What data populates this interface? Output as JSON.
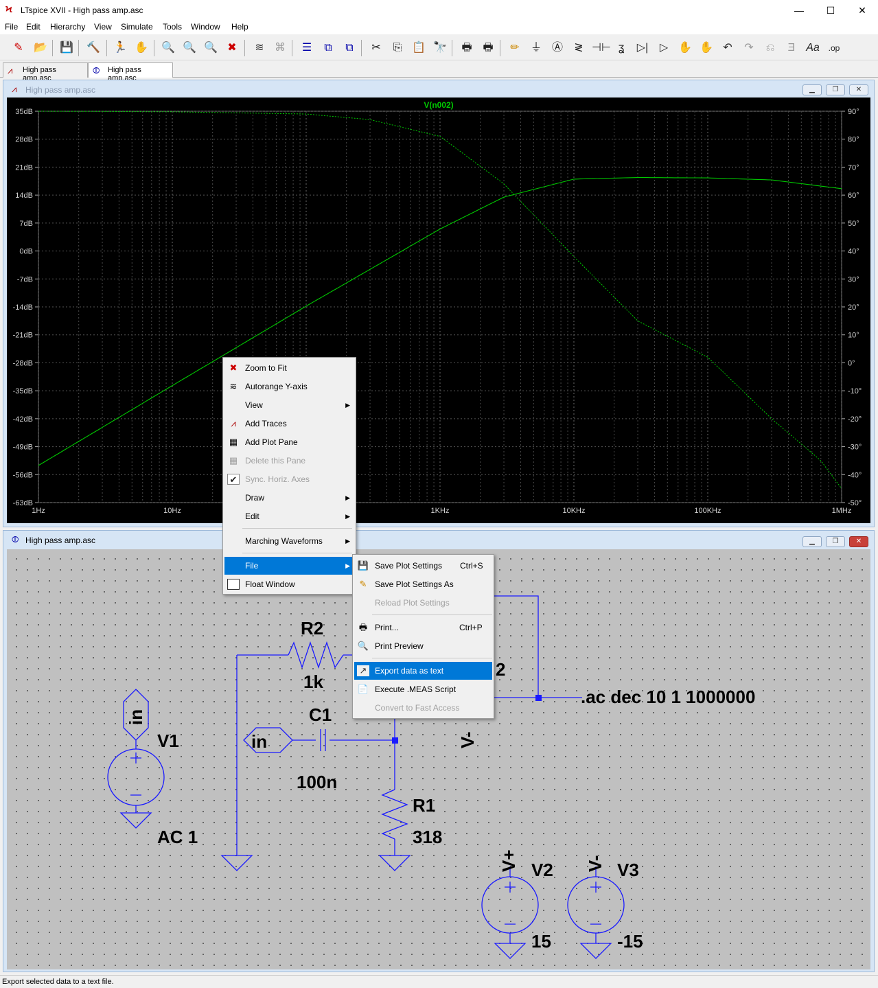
{
  "window": {
    "title": "LTspice XVII - High pass amp.asc",
    "min": "—",
    "max": "☐",
    "close": "✕"
  },
  "menubar": [
    "File",
    "Edit",
    "Hierarchy",
    "View",
    "Simulate",
    "Tools",
    "Window",
    "Help"
  ],
  "tabs": [
    {
      "label": "High pass amp.asc",
      "icon": "waveform-icon"
    },
    {
      "label": "High pass amp.asc",
      "icon": "schematic-icon"
    }
  ],
  "plot_window": {
    "title": "High pass amp.asc",
    "trace_label": "V(n002)",
    "trace_color": "#00c800",
    "x_ticks": [
      "1Hz",
      "10Hz",
      "100Hz",
      "1KHz",
      "10KHz",
      "100KHz",
      "1MHz"
    ],
    "left_ticks": [
      "35dB",
      "28dB",
      "21dB",
      "14dB",
      "7dB",
      "0dB",
      "-7dB",
      "-14dB",
      "-21dB",
      "-28dB",
      "-35dB",
      "-42dB",
      "-49dB",
      "-56dB",
      "-63dB"
    ],
    "right_ticks": [
      "90°",
      "80°",
      "70°",
      "60°",
      "50°",
      "40°",
      "30°",
      "20°",
      "10°",
      "0°",
      "-10°",
      "-20°",
      "-30°",
      "-40°",
      "-50°"
    ]
  },
  "chart_data": {
    "type": "line",
    "title": "V(n002)",
    "x_scale": "log",
    "xlim": [
      1,
      1000000
    ],
    "ylim_left": [
      -63,
      35
    ],
    "ylim_right": [
      -50,
      90
    ],
    "grid": true,
    "series": [
      {
        "name": "V(n002)",
        "axis": "magnitude",
        "unit": "dB",
        "x": [
          1,
          10,
          100,
          1000,
          3000,
          10000,
          30000,
          100000,
          300000,
          1000000
        ],
        "y": [
          -53.7,
          -33.7,
          -13.8,
          5.5,
          13.5,
          18.0,
          18.4,
          18.3,
          17.8,
          15.6
        ]
      },
      {
        "name": "V(n002)",
        "axis": "phase",
        "unit": "°",
        "x": [
          1,
          10,
          100,
          300,
          1000,
          3000,
          10000,
          30000,
          100000,
          300000,
          700000,
          1000000
        ],
        "y": [
          90,
          89.8,
          89,
          87,
          81,
          64,
          38,
          15,
          2,
          -20,
          -35,
          -45
        ]
      }
    ]
  },
  "context_menu": {
    "items": [
      {
        "label": "Zoom to Fit",
        "icon": "zoom-fit-icon",
        "submenu": false,
        "disabled": false
      },
      {
        "label": "Autorange Y-axis",
        "icon": "autorange-icon",
        "submenu": false,
        "disabled": false
      },
      {
        "label": "View",
        "icon": "",
        "submenu": true,
        "disabled": false
      },
      {
        "label": "Add Traces",
        "icon": "add-traces-icon",
        "submenu": false,
        "disabled": false
      },
      {
        "label": "Add Plot Pane",
        "icon": "add-pane-icon",
        "submenu": false,
        "disabled": false
      },
      {
        "label": "Delete this Pane",
        "icon": "delete-pane-icon",
        "submenu": false,
        "disabled": true
      },
      {
        "label": "Sync. Horiz. Axes",
        "icon": "checkmark-icon",
        "submenu": false,
        "disabled": true
      },
      {
        "label": "Draw",
        "icon": "",
        "submenu": true,
        "disabled": false
      },
      {
        "label": "Edit",
        "icon": "",
        "submenu": true,
        "disabled": false
      },
      {
        "label": "Marching Waveforms",
        "icon": "",
        "submenu": true,
        "disabled": false
      },
      {
        "label": "File",
        "icon": "",
        "submenu": true,
        "disabled": false
      },
      {
        "label": "Float Window",
        "icon": "float-window-icon",
        "submenu": false,
        "disabled": false
      }
    ]
  },
  "file_submenu": {
    "items": [
      {
        "label": "Save Plot Settings",
        "shortcut": "Ctrl+S",
        "disabled": false
      },
      {
        "label": "Save Plot Settings As",
        "shortcut": "",
        "disabled": false
      },
      {
        "label": "Reload Plot Settings",
        "shortcut": "",
        "disabled": true
      },
      {
        "label": "Print...",
        "shortcut": "Ctrl+P",
        "disabled": false
      },
      {
        "label": "Print Preview",
        "shortcut": "",
        "disabled": false
      },
      {
        "label": "Export data as text",
        "shortcut": "",
        "disabled": false
      },
      {
        "label": "Execute .MEAS Script",
        "shortcut": "",
        "disabled": false
      },
      {
        "label": "Convert to Fast Access",
        "shortcut": "",
        "disabled": true
      }
    ]
  },
  "schematic": {
    "title": "High pass amp.asc",
    "labels": {
      "r2_name": "R2",
      "r2_value": "1k",
      "c1_name": "C1",
      "c1_value": "100n",
      "r1_name": "R1",
      "r1_value": "318",
      "v1_name": "V1",
      "v1_value": "AC 1",
      "v2_name": "V2",
      "v2_value": "15",
      "v3_name": "V3",
      "v3_value": "-15",
      "in_label_v1": "in",
      "in_label_c1": "in",
      "v_plus": "V+",
      "v_minus": "V-",
      "vminus_opamp": "V-",
      "u_partial": "2",
      "directive": ".ac dec 10 1 1000000"
    }
  },
  "status": "Export selected data to a text file."
}
